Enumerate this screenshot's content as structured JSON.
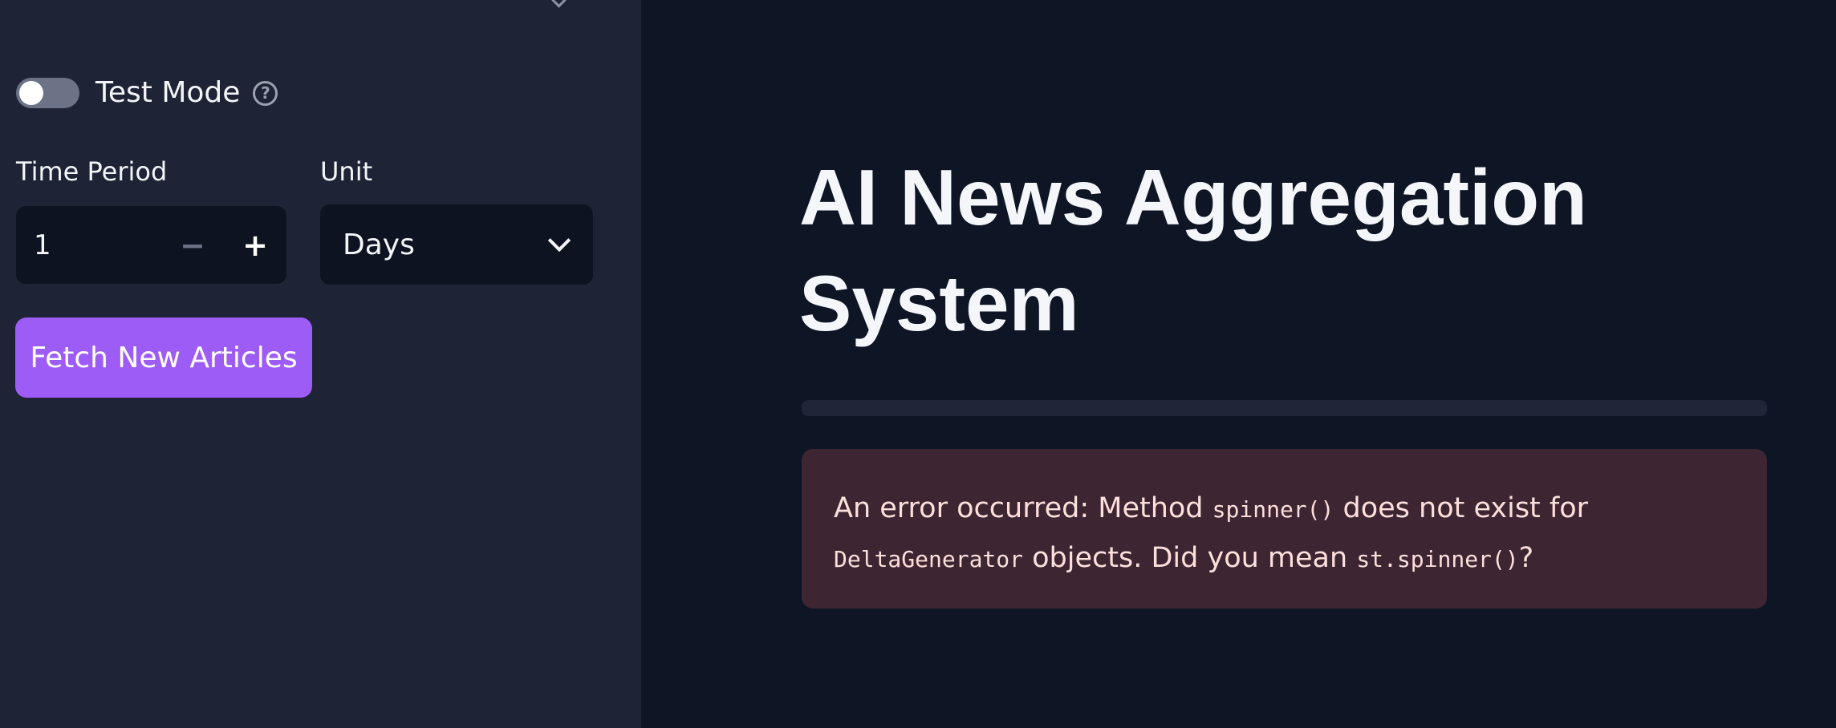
{
  "sidebar": {
    "test_mode": {
      "label": "Test Mode",
      "enabled": false,
      "help_icon": "question-circle-icon"
    },
    "time_period": {
      "label": "Time Period",
      "value": "1",
      "decrement_label": "−",
      "increment_label": "+"
    },
    "unit": {
      "label": "Unit",
      "selected": "Days",
      "icon": "chevron-down-icon"
    },
    "fetch_button_label": "Fetch New Articles"
  },
  "main": {
    "title": "AI News Aggregation System",
    "error": {
      "prefix": "An error occurred: Method ",
      "code1": "spinner()",
      "mid1": " does not exist for ",
      "code2": "DeltaGenerator",
      "mid2": " objects. Did you mean ",
      "code3": "st.spinner()",
      "suffix": "?"
    }
  },
  "colors": {
    "sidebar_bg": "#1e2435",
    "main_bg": "#0e1525",
    "primary": "#9e5cf6",
    "error_bg": "#3e2532",
    "error_text": "#fce0dc"
  }
}
